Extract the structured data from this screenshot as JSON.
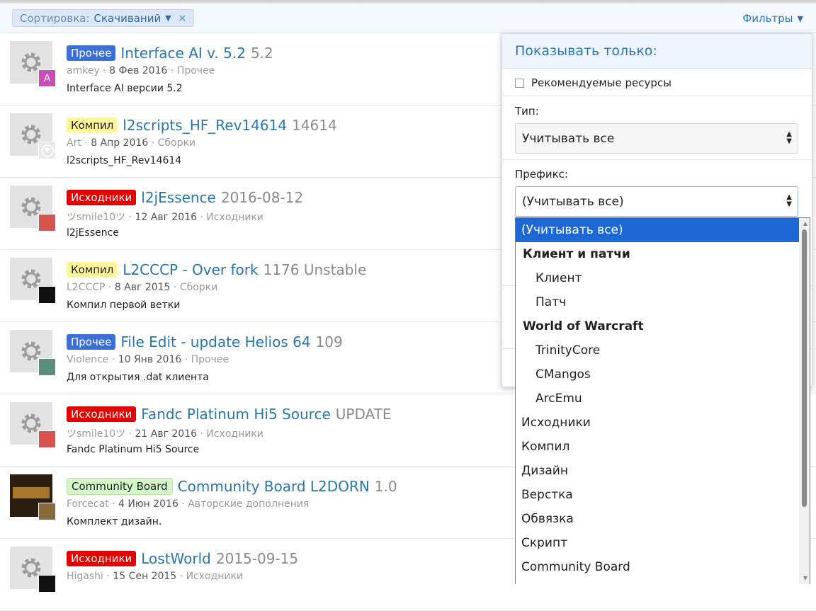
{
  "filterbar": {
    "sort_label": "Сортировка:",
    "sort_value": "Скачиваний",
    "remove_icon": "×",
    "filters_label": "Фильтры"
  },
  "resources": [
    {
      "prefix": "Прочее",
      "prefix_color": "#3d6fd9",
      "title": "Interface AI v. 5.2",
      "version": "5.2",
      "author": "amkey",
      "date": "8 Фев 2016",
      "category": "Прочее",
      "description": "Interface AI версии 5.2",
      "avatar_letter": "A"
    },
    {
      "prefix": "Компил",
      "prefix_color": "#fff59a",
      "title": "l2scripts_HF_Rev14614",
      "version": "14614",
      "author": "Art",
      "date": "8 Апр 2016",
      "category": "Сборки",
      "description": "l2scripts_HF_Rev14614",
      "avatar_letter": ""
    },
    {
      "prefix": "Исходники",
      "prefix_color": "#e30000",
      "title": "l2jEssence",
      "version": "2016-08-12",
      "author": "ツsmile10ツ",
      "date": "12 Авг 2016",
      "category": "Исходники",
      "description": "l2jEssence",
      "avatar_letter": ""
    },
    {
      "prefix": "Компил",
      "prefix_color": "#fff59a",
      "title": "L2CCCP - Over fork",
      "version": "1176 Unstable",
      "author": "L2CCCP",
      "date": "8 Авг 2015",
      "category": "Сборки",
      "description": "Компил первой ветки",
      "avatar_letter": ""
    },
    {
      "prefix": "Прочее",
      "prefix_color": "#3d6fd9",
      "title": "File Edit - update Helios 64",
      "version": "109",
      "author": "Violence",
      "date": "10 Янв 2016",
      "category": "Прочее",
      "description": "Для открытия .dat клиента",
      "avatar_letter": ""
    },
    {
      "prefix": "Исходники",
      "prefix_color": "#e30000",
      "title": "Fandc Platinum Hi5 Source",
      "version": "UPDATE",
      "author": "ツsmile10ツ",
      "date": "21 Авг 2016",
      "category": "Исходники",
      "description": "Fandc Platinum Hi5 Source",
      "avatar_letter": ""
    },
    {
      "prefix": "Community Board",
      "prefix_color": "#d4f7c9",
      "title": "Community Board L2DORN",
      "version": "1.0",
      "author": "Forcecat",
      "date": "4 Июн 2016",
      "category": "Авторские дополнения",
      "description": "Комплект дизайн.",
      "avatar_letter": ""
    },
    {
      "prefix": "Исходники",
      "prefix_color": "#e30000",
      "title": "LostWorld",
      "version": "2015-09-15",
      "author": "Higashi",
      "date": "15 Сен 2015",
      "category": "Исходники",
      "description": "",
      "avatar_letter": ""
    }
  ],
  "panel": {
    "title": "Показывать только:",
    "featured_label": "Рекомендуемые ресурсы",
    "type_label": "Тип:",
    "type_value": "Учитывать все",
    "prefix_label": "Префикс:",
    "prefix_value": "(Учитывать все)"
  },
  "dropdown": {
    "options": [
      {
        "label": "(Учитывать все)",
        "kind": "selected"
      },
      {
        "label": "Клиент и патчи",
        "kind": "group"
      },
      {
        "label": "Клиент",
        "kind": "sub"
      },
      {
        "label": "Патч",
        "kind": "sub"
      },
      {
        "label": "World of Warcraft",
        "kind": "group"
      },
      {
        "label": "TrinityCore",
        "kind": "sub"
      },
      {
        "label": "CMangos",
        "kind": "sub"
      },
      {
        "label": "ArcEmu",
        "kind": "sub"
      },
      {
        "label": "Исходники",
        "kind": "item"
      },
      {
        "label": "Компил",
        "kind": "item"
      },
      {
        "label": "Дизайн",
        "kind": "item"
      },
      {
        "label": "Верстка",
        "kind": "item"
      },
      {
        "label": "Обвязка",
        "kind": "item"
      },
      {
        "label": "Скрипт",
        "kind": "item"
      },
      {
        "label": "Community Board",
        "kind": "item"
      }
    ]
  },
  "colors": {
    "link": "#2577b1",
    "selected_option": "#1e68d6"
  }
}
